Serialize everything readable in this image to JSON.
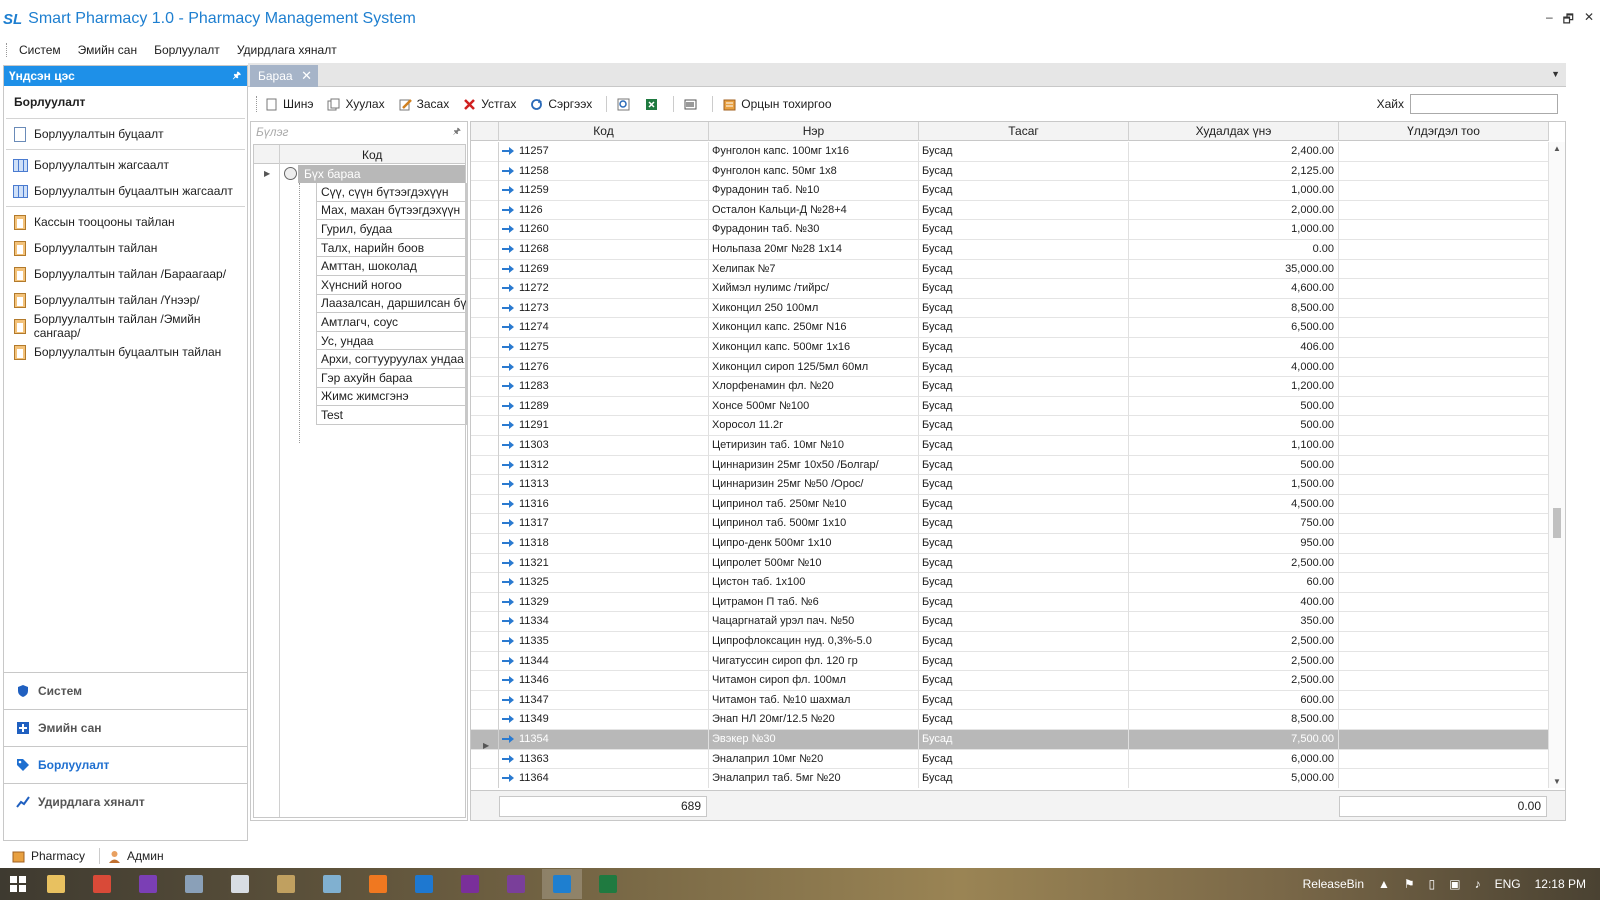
{
  "window": {
    "logo": "SL",
    "title": "Smart Pharmacy 1.0 - Pharmacy Management System",
    "controls": [
      "–",
      "🗗",
      "✕"
    ]
  },
  "menu": [
    "Систем",
    "Эмийн сан",
    "Борлуулалт",
    "Удирдлага хяналт"
  ],
  "sidebar": {
    "header": "Үндсэн цэс",
    "pin": "🖈",
    "section_title": "Борлуулалт",
    "groups": [
      [
        {
          "label": "Борлуулалтын буцаалт",
          "icon": "document-edit-icon"
        }
      ],
      [
        {
          "label": "Борлуулалтын жагсаалт",
          "icon": "grid-icon"
        },
        {
          "label": "Борлуулалтын буцаалтын жагсаалт",
          "icon": "grid-icon"
        }
      ],
      [
        {
          "label": "Кассын тооцооны тайлан",
          "icon": "clipboard-icon"
        },
        {
          "label": "Борлуулалтын тайлан",
          "icon": "clipboard-icon"
        },
        {
          "label": "Борлуулалтын тайлан /Бараагаар/",
          "icon": "clipboard-icon"
        },
        {
          "label": "Борлуулалтын тайлан /Үнээр/",
          "icon": "clipboard-icon"
        },
        {
          "label": "Борлуулалтын тайлан /Эмийн сангаар/",
          "icon": "clipboard-icon"
        },
        {
          "label": "Борлуулалтын буцаалтын тайлан",
          "icon": "clipboard-icon"
        }
      ]
    ],
    "nav": [
      {
        "label": "Систем",
        "active": false,
        "color": "#2060c0"
      },
      {
        "label": "Эмийн сан",
        "active": false,
        "color": "#2060c0"
      },
      {
        "label": "Борлуулалт",
        "active": true,
        "color": "#1e6fd0"
      },
      {
        "label": "Удирдлага хяналт",
        "active": false,
        "color": "#2060c0"
      }
    ]
  },
  "tabs": [
    {
      "label": "Бараа",
      "close": "✕"
    }
  ],
  "toolbar": {
    "new": "Шинэ",
    "copy": "Хуулах",
    "edit": "Засах",
    "delete": "Устгах",
    "refresh": "Сэргээх",
    "translate": "Орцын тохиргоо",
    "search_label": "Хайх",
    "search_value": ""
  },
  "groups_panel": {
    "header": "Бүлэг",
    "column": "Код",
    "root": "Бүх бараа",
    "children": [
      "Сүү, сүүн бүтээгдэхүүн",
      "Мах, махан бүтээгдэхүүн",
      "Гурил, будаа",
      "Талх, нарийн боов",
      "Амттан, шоколад",
      "Хүнсний ногоо",
      "Лаазалсан, даршилсан бүтээгдэхүүн",
      "Амтлагч, соус",
      "Ус, ундаа",
      "Архи, согтууруулах ундаа",
      "Гэр ахуйн бараа",
      "Жимс жимсгэнэ",
      "Test"
    ]
  },
  "grid": {
    "columns": [
      "Код",
      "Нэр",
      "Тасаг",
      "Худалдах үнэ",
      "Үлдэгдэл тоо"
    ],
    "rows": [
      {
        "code": "11257",
        "name": "Фунголон капс. 100мг 1х16",
        "cat": "Бусад",
        "price": "2,400.00",
        "qty": ""
      },
      {
        "code": "11258",
        "name": "Фунголон капс. 50мг 1х8",
        "cat": "Бусад",
        "price": "2,125.00",
        "qty": ""
      },
      {
        "code": "11259",
        "name": "Фурадонин таб. №10",
        "cat": "Бусад",
        "price": "1,000.00",
        "qty": ""
      },
      {
        "code": "1126",
        "name": "Осталон Кальци-Д №28+4",
        "cat": "Бусад",
        "price": "2,000.00",
        "qty": ""
      },
      {
        "code": "11260",
        "name": "Фурадонин таб. №30",
        "cat": "Бусад",
        "price": "1,000.00",
        "qty": ""
      },
      {
        "code": "11268",
        "name": "Нольпаза 20мг №28 1х14",
        "cat": "Бусад",
        "price": "0.00",
        "qty": ""
      },
      {
        "code": "11269",
        "name": "Хелипак №7",
        "cat": "Бусад",
        "price": "35,000.00",
        "qty": ""
      },
      {
        "code": "11272",
        "name": "Хиймэл нулимс /тийрс/",
        "cat": "Бусад",
        "price": "4,600.00",
        "qty": ""
      },
      {
        "code": "11273",
        "name": "Хиконцил 250 100мл",
        "cat": "Бусад",
        "price": "8,500.00",
        "qty": ""
      },
      {
        "code": "11274",
        "name": "Хиконцил капс. 250мг N16",
        "cat": "Бусад",
        "price": "6,500.00",
        "qty": ""
      },
      {
        "code": "11275",
        "name": "Хиконцил капс. 500мг 1х16",
        "cat": "Бусад",
        "price": "406.00",
        "qty": ""
      },
      {
        "code": "11276",
        "name": "Хиконцил сироп 125/5мл 60мл",
        "cat": "Бусад",
        "price": "4,000.00",
        "qty": ""
      },
      {
        "code": "11283",
        "name": "Хлорфенамин фл. №20",
        "cat": "Бусад",
        "price": "1,200.00",
        "qty": ""
      },
      {
        "code": "11289",
        "name": "Хонсе 500мг №100",
        "cat": "Бусад",
        "price": "500.00",
        "qty": ""
      },
      {
        "code": "11291",
        "name": "Хоросол 11.2г",
        "cat": "Бусад",
        "price": "500.00",
        "qty": ""
      },
      {
        "code": "11303",
        "name": "Цетиризин таб. 10мг №10",
        "cat": "Бусад",
        "price": "1,100.00",
        "qty": ""
      },
      {
        "code": "11312",
        "name": "Циннаризин 25мг 10х50 /Болгар/",
        "cat": "Бусад",
        "price": "500.00",
        "qty": ""
      },
      {
        "code": "11313",
        "name": "Циннаризин 25мг №50 /Орос/",
        "cat": "Бусад",
        "price": "1,500.00",
        "qty": ""
      },
      {
        "code": "11316",
        "name": "Ципринол таб. 250мг №10",
        "cat": "Бусад",
        "price": "4,500.00",
        "qty": ""
      },
      {
        "code": "11317",
        "name": "Ципринол таб. 500мг 1х10",
        "cat": "Бусад",
        "price": "750.00",
        "qty": ""
      },
      {
        "code": "11318",
        "name": "Ципро-денк 500мг 1х10",
        "cat": "Бусад",
        "price": "950.00",
        "qty": ""
      },
      {
        "code": "11321",
        "name": "Ципролет 500мг №10",
        "cat": "Бусад",
        "price": "2,500.00",
        "qty": ""
      },
      {
        "code": "11325",
        "name": "Цистон таб. 1х100",
        "cat": "Бусад",
        "price": "60.00",
        "qty": ""
      },
      {
        "code": "11329",
        "name": "Цитрамон П таб. №6",
        "cat": "Бусад",
        "price": "400.00",
        "qty": ""
      },
      {
        "code": "11334",
        "name": "Чацаргнатай урэл пач. №50",
        "cat": "Бусад",
        "price": "350.00",
        "qty": ""
      },
      {
        "code": "11335",
        "name": "Ципрофлоксацин нуд. 0,3%-5.0",
        "cat": "Бусад",
        "price": "2,500.00",
        "qty": ""
      },
      {
        "code": "11344",
        "name": "Чигатуссин сироп фл. 120 гр",
        "cat": "Бусад",
        "price": "2,500.00",
        "qty": ""
      },
      {
        "code": "11346",
        "name": "Читамон сироп фл. 100мл",
        "cat": "Бусад",
        "price": "2,500.00",
        "qty": ""
      },
      {
        "code": "11347",
        "name": "Читамон таб. №10 шахмал",
        "cat": "Бусад",
        "price": "600.00",
        "qty": ""
      },
      {
        "code": "11349",
        "name": "Энап НЛ 20мг/12.5 №20",
        "cat": "Бусад",
        "price": "8,500.00",
        "qty": ""
      },
      {
        "code": "11354",
        "name": "Эвэкер №30",
        "cat": "Бусад",
        "price": "7,500.00",
        "qty": "",
        "selected": true
      },
      {
        "code": "11363",
        "name": "Эналаприл 10мг №20",
        "cat": "Бусад",
        "price": "6,000.00",
        "qty": ""
      },
      {
        "code": "11364",
        "name": "Эналаприл таб. 5мг №20",
        "cat": "Бусад",
        "price": "5,000.00",
        "qty": ""
      }
    ],
    "footer_count": "689",
    "footer_total": "0.00"
  },
  "statusbar": {
    "app": "Pharmacy",
    "user": "Админ"
  },
  "taskbar": {
    "apps": [
      {
        "icon": "explorer-icon",
        "color": "#e8c160"
      },
      {
        "icon": "chrome-icon",
        "color": "#d94a38"
      },
      {
        "icon": "visual-studio-icon",
        "color": "#7b3fb5"
      },
      {
        "icon": "server-icon",
        "color": "#8aa0b8"
      },
      {
        "icon": "notepad-icon",
        "color": "#d8dde3"
      },
      {
        "icon": "tools-icon",
        "color": "#c0a060"
      },
      {
        "icon": "network-icon",
        "color": "#80b0d0"
      },
      {
        "icon": "forward-icon",
        "color": "#f07820"
      },
      {
        "icon": "teamviewer-icon",
        "color": "#1e78d0"
      },
      {
        "icon": "onenote-icon",
        "color": "#7a2f9a"
      },
      {
        "icon": "visual-studio-alt-icon",
        "color": "#7a3f9a"
      },
      {
        "icon": "smart-pharmacy-icon",
        "color": "#1e7fd0",
        "active": true
      },
      {
        "icon": "excel-icon",
        "color": "#1f7a40"
      }
    ],
    "tray": {
      "release": "ReleaseBin",
      "lang": "ENG",
      "time": "12:18 PM"
    }
  }
}
